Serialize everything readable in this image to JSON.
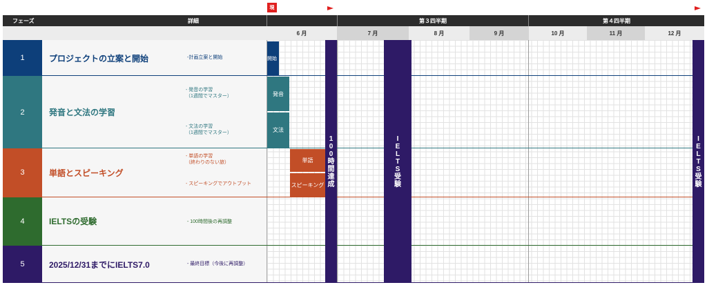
{
  "marker": {
    "now_label": "現"
  },
  "header": {
    "phase_label": "フェーズ",
    "detail_label": "詳細",
    "q3_label": "第３四半期",
    "q4_label": "第４四半期",
    "months": [
      "6 月",
      "7 月",
      "8 月",
      "9 月",
      "10 月",
      "11 月",
      "12 月"
    ]
  },
  "phases": [
    {
      "num": "1",
      "title": "プロジェクトの立案と開始",
      "details": [
        "-計画立案と開始"
      ],
      "color": "#0d3f7a"
    },
    {
      "num": "2",
      "title": "発音と文法の学習",
      "details": [
        "- 発音の学習\n（1週間でマスター）",
        "- 文法の学習\n（1週間でマスター）"
      ],
      "color": "#2f7780"
    },
    {
      "num": "3",
      "title": "単語とスピーキング",
      "details": [
        "- 単語の学習\n（終わりのない旅）",
        "- スピーキングでアウトプット"
      ],
      "color": "#c24e27"
    },
    {
      "num": "4",
      "title": "IELTSの受験",
      "details": [
        "- 100時間後の再調整"
      ],
      "color": "#2e6b2e"
    },
    {
      "num": "5",
      "title": "2025/12/31までにIELTS7.0",
      "details": [
        "- 最終目標（今後に再調整）"
      ],
      "color": "#2e1a66"
    }
  ],
  "bars": {
    "start": "開始",
    "pronunciation": "発音",
    "grammar": "文法",
    "vocabulary": "単語",
    "speaking": "スピーキング"
  },
  "milestones": {
    "hours_100": "100時間達成",
    "ielts_1": "IELTS受験",
    "ielts_2": "IELTS受験"
  },
  "colors": {
    "dark_header": "#2c2c2c",
    "milestone": "#2e1a66",
    "flag": "#e0201f"
  }
}
